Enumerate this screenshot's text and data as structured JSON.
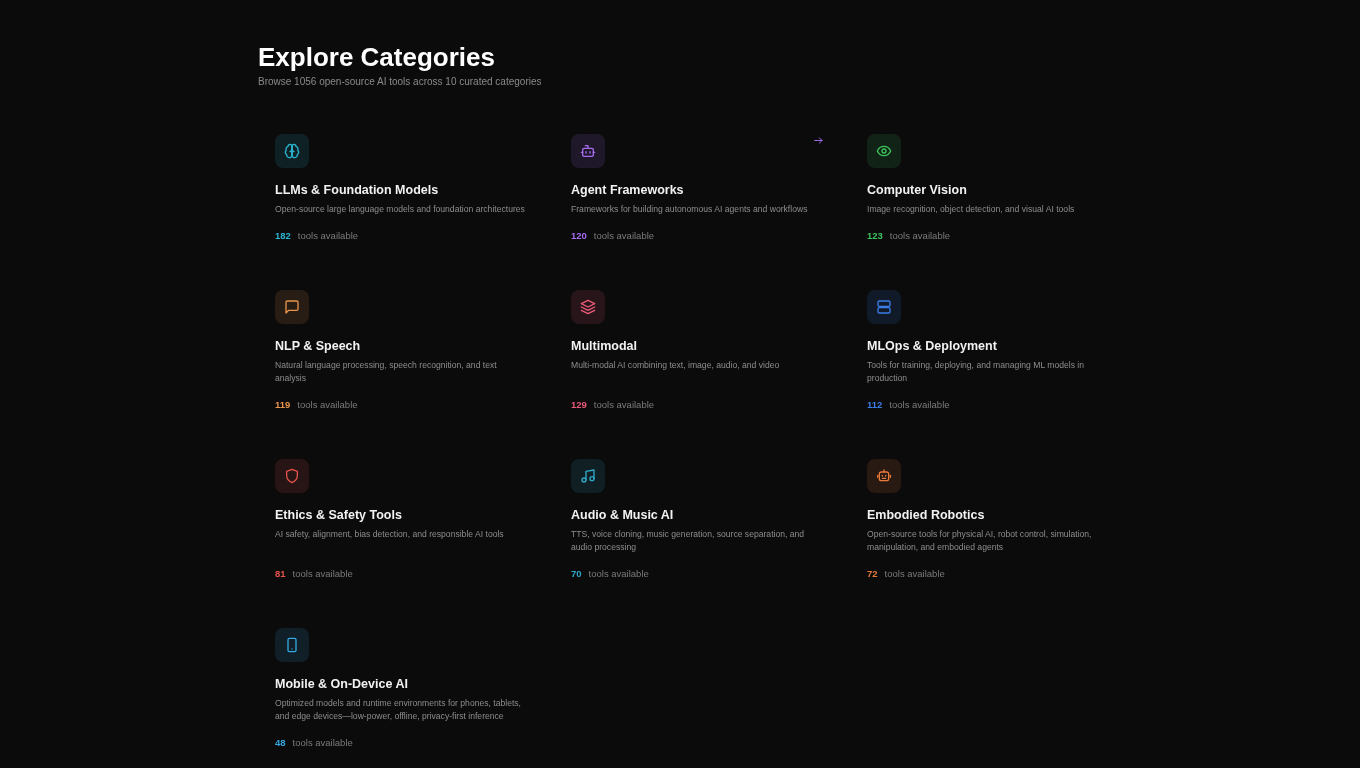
{
  "header": {
    "title": "Explore Categories",
    "subtitle": "Browse 1056 open-source AI tools across 10 curated categories"
  },
  "categories": [
    {
      "name": "LLMs & Foundation Models",
      "description": "Open-source large language models and foundation architectures",
      "count": "182",
      "count_label": "tools available",
      "color": "#2bb5d0",
      "hovered": false
    },
    {
      "name": "Agent Frameworks",
      "description": "Frameworks for building autonomous AI agents and workflows",
      "count": "120",
      "count_label": "tools available",
      "color": "#a66cf0",
      "hovered": true
    },
    {
      "name": "Computer Vision",
      "description": "Image recognition, object detection, and visual AI tools",
      "count": "123",
      "count_label": "tools available",
      "color": "#3cc35a",
      "hovered": false
    },
    {
      "name": "NLP & Speech",
      "description": "Natural language processing, speech recognition, and text analysis",
      "count": "119",
      "count_label": "tools available",
      "color": "#e8954a",
      "hovered": false
    },
    {
      "name": "Multimodal",
      "description": "Multi-modal AI combining text, image, audio, and video",
      "count": "129",
      "count_label": "tools available",
      "color": "#e85a78",
      "hovered": false
    },
    {
      "name": "MLOps & Deployment",
      "description": "Tools for training, deploying, and managing ML models in production",
      "count": "112",
      "count_label": "tools available",
      "color": "#3b7ee8",
      "hovered": false
    },
    {
      "name": "Ethics & Safety Tools",
      "description": "AI safety, alignment, bias detection, and responsible AI tools",
      "count": "81",
      "count_label": "tools available",
      "color": "#e5534b",
      "hovered": false
    },
    {
      "name": "Audio & Music AI",
      "description": "TTS, voice cloning, music generation, source separation, and audio processing",
      "count": "70",
      "count_label": "tools available",
      "color": "#2fa8c8",
      "hovered": false
    },
    {
      "name": "Embodied Robotics",
      "description": "Open-source tools for physical AI, robot control, simulation, manipulation, and embodied agents",
      "count": "72",
      "count_label": "tools available",
      "color": "#e87a3a",
      "hovered": false
    },
    {
      "name": "Mobile & On-Device AI",
      "description": "Optimized models and runtime environments for phones, tablets, and edge devices—low-power, offline, privacy-first inference",
      "count": "48",
      "count_label": "tools available",
      "color": "#35a8e0",
      "hovered": false
    }
  ]
}
